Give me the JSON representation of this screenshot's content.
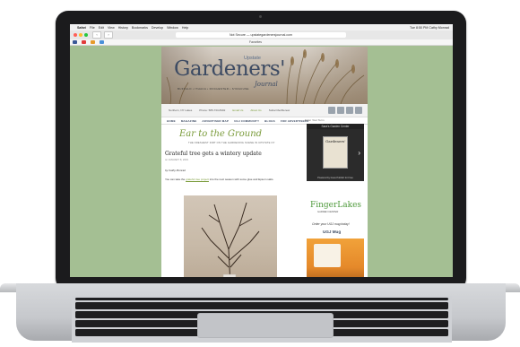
{
  "menubar": {
    "items": [
      "Safari",
      "File",
      "Edit",
      "View",
      "History",
      "Bookmarks",
      "Develop",
      "Window",
      "Help"
    ],
    "right": "Tue 8:50 PM   Cathy Monrad"
  },
  "browser": {
    "url": "Not Secure — upstategardenersjournal.com",
    "bookmarks": "Favorites"
  },
  "site": {
    "logo": "Gardeners'",
    "logo_upstate": "Upstate",
    "logo_journal": "Journal",
    "tagline": "BUFFALO • ITHACA • ROCHESTER • SYRACUSE",
    "info": [
      "Northern, NY Lakes",
      "Phone: 585-733-8302",
      "Email Us",
      "About Us",
      "Subscribe/Renew"
    ],
    "nav": [
      "HOME",
      "MAGAZINE",
      "ADVERTISER MAP",
      "UGJ COMMUNITY",
      "BLOGS",
      "FOR ADVERTISERS"
    ],
    "search_placeholder": "Enter Your Term"
  },
  "post": {
    "section_title": "Ear to the Ground",
    "section_sub": "THE FRESHEST DIRT ON THE GARDENING SCENE IN UPSTATE NY",
    "title": "Grateful tree gets a wintery update",
    "date": "on JANUARY 8, 2019",
    "byline": "by Cathy Monrad",
    "body_pre": "You can take the ",
    "body_link": "grateful tree project",
    "body_post": " into the next season with some glue and Epsom salts."
  },
  "sidebar": {
    "widget_header": "Sara's Garden Center",
    "magazine_title": "Gardeners'",
    "widget_footer": "Powered by  Issuu    Publish for Free",
    "fingerlakes": "FingerLakes",
    "fingerlakes_sub": "GARDEN CENTER",
    "order_text": "Order your UGJ mug today!",
    "mug_title": "UGJ Mug"
  }
}
